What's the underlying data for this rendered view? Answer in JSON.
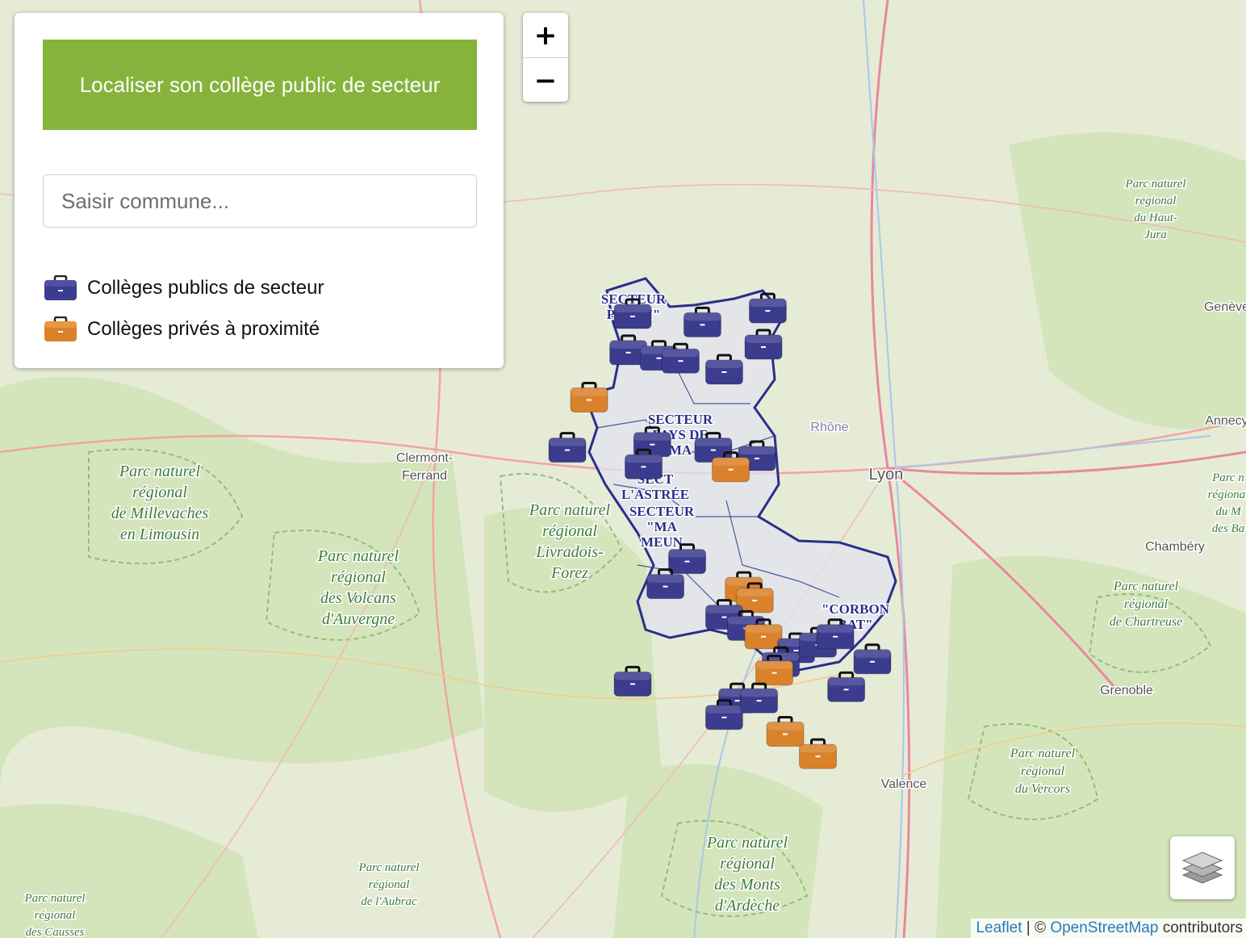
{
  "panel": {
    "title_button": "Localiser son collège public de secteur",
    "commune_placeholder": "Saisir commune...",
    "legend": [
      {
        "label": "Collèges publics de secteur",
        "color": "#3b3c8e"
      },
      {
        "label": "Collèges privés à proximité",
        "color": "#d9822b"
      }
    ]
  },
  "zoom": {
    "in_label": "+",
    "out_label": "−"
  },
  "attribution": {
    "leaflet": "Leaflet",
    "separator": " | © ",
    "osm": "OpenStreetMap",
    "suffix": " contributors"
  },
  "map": {
    "colors": {
      "sector_outline": "#2a2f8a",
      "sector_fill": "#e2e2ee",
      "public": "#3b3c8e",
      "private": "#d9822b",
      "park_label": "#3d7a3d",
      "city_label": "#555555"
    },
    "place_labels": [
      "Clermont-",
      "Ferrand",
      "Lyon",
      "Rhône",
      "Genève",
      "Annecy",
      "Chambéry",
      "Grenoble",
      "Valence"
    ],
    "park_labels": [
      [
        "Parc naturel",
        "régional",
        "de Millevaches",
        "en Limousin"
      ],
      [
        "Parc naturel",
        "régional",
        "des Volcans",
        "d'Auvergne"
      ],
      [
        "Parc naturel",
        "régional",
        "Livradois-",
        "Forez"
      ],
      [
        "Parc naturel",
        "régional",
        "du Haut-",
        "Jura"
      ],
      [
        "Parc n",
        "régional",
        "du M",
        "des Ba"
      ],
      [
        "Parc naturel",
        "régional",
        "de Chartreuse"
      ],
      [
        "Parc naturel",
        "régional",
        "du Vercors"
      ],
      [
        "Parc naturel",
        "régional",
        "des Monts",
        "d'Ardèche"
      ],
      [
        "Parc naturel",
        "régional",
        "de l'Aubrac"
      ],
      [
        "Parc naturel",
        "régional",
        "des Causses"
      ]
    ],
    "sector_labels": [
      [
        "SECTEUR",
        "PAPON\""
      ],
      [
        "SECTEUR",
        "PAYS DE",
        "MA"
      ],
      [
        "SECT",
        "L'ASTRÉE"
      ],
      [
        "SECTEUR",
        "\"MA",
        "MEUN"
      ],
      [
        "\"CORBON",
        "BAT\""
      ]
    ],
    "markers": [
      {
        "type": "public",
        "lng": 4.1,
        "lat": 46.1
      },
      {
        "type": "public",
        "lng": 4.42,
        "lat": 46.07
      },
      {
        "type": "public",
        "lng": 4.72,
        "lat": 46.12
      },
      {
        "type": "public",
        "lng": 4.7,
        "lat": 45.99
      },
      {
        "type": "public",
        "lng": 4.08,
        "lat": 45.97
      },
      {
        "type": "public",
        "lng": 4.22,
        "lat": 45.95
      },
      {
        "type": "public",
        "lng": 4.32,
        "lat": 45.94
      },
      {
        "type": "public",
        "lng": 4.52,
        "lat": 45.9
      },
      {
        "type": "private",
        "lng": 3.9,
        "lat": 45.8
      },
      {
        "type": "public",
        "lng": 3.8,
        "lat": 45.62
      },
      {
        "type": "public",
        "lng": 4.19,
        "lat": 45.64
      },
      {
        "type": "public",
        "lng": 4.47,
        "lat": 45.62
      },
      {
        "type": "public",
        "lng": 4.67,
        "lat": 45.59
      },
      {
        "type": "private",
        "lng": 4.55,
        "lat": 45.55
      },
      {
        "type": "public",
        "lng": 4.15,
        "lat": 45.56
      },
      {
        "type": "public",
        "lng": 4.35,
        "lat": 45.22
      },
      {
        "type": "public",
        "lng": 4.25,
        "lat": 45.13
      },
      {
        "type": "private",
        "lng": 4.61,
        "lat": 45.12
      },
      {
        "type": "private",
        "lng": 4.66,
        "lat": 45.08
      },
      {
        "type": "public",
        "lng": 4.52,
        "lat": 45.02
      },
      {
        "type": "public",
        "lng": 4.62,
        "lat": 44.98
      },
      {
        "type": "private",
        "lng": 4.7,
        "lat": 44.95
      },
      {
        "type": "public",
        "lng": 4.85,
        "lat": 44.9
      },
      {
        "type": "public",
        "lng": 4.95,
        "lat": 44.92
      },
      {
        "type": "public",
        "lng": 5.03,
        "lat": 44.95
      },
      {
        "type": "public",
        "lng": 4.78,
        "lat": 44.85
      },
      {
        "type": "private",
        "lng": 4.75,
        "lat": 44.82
      },
      {
        "type": "public",
        "lng": 5.2,
        "lat": 44.86
      },
      {
        "type": "public",
        "lng": 4.1,
        "lat": 44.78
      },
      {
        "type": "public",
        "lng": 5.08,
        "lat": 44.76
      },
      {
        "type": "public",
        "lng": 4.58,
        "lat": 44.72
      },
      {
        "type": "public",
        "lng": 4.52,
        "lat": 44.66
      },
      {
        "type": "private",
        "lng": 4.8,
        "lat": 44.6
      },
      {
        "type": "private",
        "lng": 4.95,
        "lat": 44.52
      },
      {
        "type": "public",
        "lng": 4.68,
        "lat": 44.72
      }
    ]
  }
}
